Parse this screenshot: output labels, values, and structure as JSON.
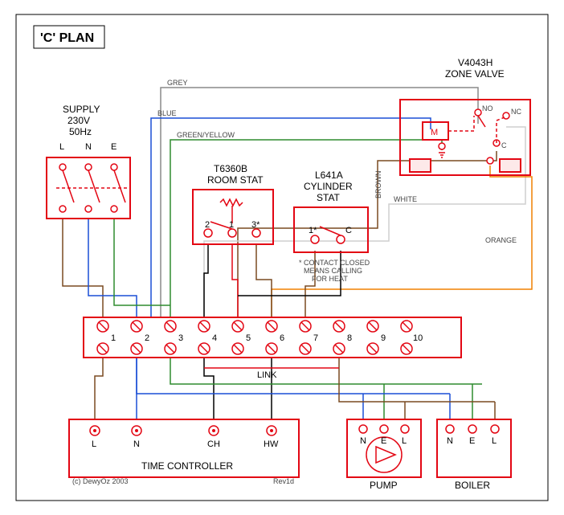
{
  "title": "'C' PLAN",
  "supply": {
    "label": "SUPPLY",
    "voltage": "230V",
    "freq": "50Hz",
    "terms": [
      "L",
      "N",
      "E"
    ]
  },
  "zone_valve": {
    "model": "V4043H",
    "label": "ZONE VALVE",
    "m": "M",
    "no": "NO",
    "nc": "NC",
    "c": "C",
    "earth": "⏚"
  },
  "room_stat": {
    "model": "T6360B",
    "label": "ROOM STAT",
    "terms": [
      "2",
      "1",
      "3*"
    ]
  },
  "cyl_stat": {
    "model": "L641A",
    "label": "CYLINDER",
    "label2": "STAT",
    "t1": "1*",
    "tc": "C",
    "note1": "* CONTACT CLOSED",
    "note2": "MEANS CALLING",
    "note3": "FOR HEAT"
  },
  "terminal": {
    "link": "LINK",
    "nums": [
      "1",
      "2",
      "3",
      "4",
      "5",
      "6",
      "7",
      "8",
      "9",
      "10"
    ]
  },
  "time_ctrl": {
    "label": "TIME CONTROLLER",
    "terms": [
      "L",
      "N",
      "CH",
      "HW"
    ]
  },
  "pump": {
    "label": "PUMP",
    "terms": [
      "N",
      "E",
      "L"
    ]
  },
  "boiler": {
    "label": "BOILER",
    "terms": [
      "N",
      "E",
      "L"
    ]
  },
  "wire_labels": {
    "grey": "GREY",
    "blue": "BLUE",
    "gy": "GREEN/YELLOW",
    "brown": "BROWN",
    "white": "WHITE",
    "orange": "ORANGE"
  },
  "credit": "(c) DewyOz 2003",
  "rev": "Rev1d",
  "colors": {
    "grey": "#8a8a8a",
    "blue": "#1a4fd6",
    "green": "#2e8b2e",
    "brown": "#7a4a20",
    "white": "#cfcfcf",
    "orange": "#f08000",
    "black": "#000",
    "red": "#e30613"
  }
}
